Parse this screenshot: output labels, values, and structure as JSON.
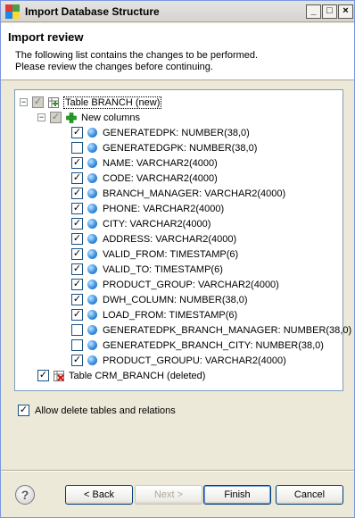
{
  "window": {
    "title": "Import Database Structure",
    "min_glyph": "_",
    "max_glyph": "□",
    "close_glyph": "×"
  },
  "header": {
    "title": "Import review",
    "desc_line1": "The following list contains the changes to be performed.",
    "desc_line2": "Please review the changes before continuing."
  },
  "tree": {
    "branch_table": {
      "label": "Table BRANCH (new)",
      "expanded": true,
      "checked": "gray"
    },
    "new_columns": {
      "label": "New columns",
      "expanded": true,
      "checked": "gray"
    },
    "columns": [
      {
        "label": "GENERATEDPK: NUMBER(38,0)",
        "checked": true
      },
      {
        "label": "GENERATEDGPK: NUMBER(38,0)",
        "checked": false
      },
      {
        "label": "NAME: VARCHAR2(4000)",
        "checked": true
      },
      {
        "label": "CODE: VARCHAR2(4000)",
        "checked": true
      },
      {
        "label": "BRANCH_MANAGER: VARCHAR2(4000)",
        "checked": true
      },
      {
        "label": "PHONE: VARCHAR2(4000)",
        "checked": true
      },
      {
        "label": "CITY: VARCHAR2(4000)",
        "checked": true
      },
      {
        "label": "ADDRESS: VARCHAR2(4000)",
        "checked": true
      },
      {
        "label": "VALID_FROM: TIMESTAMP(6)",
        "checked": true
      },
      {
        "label": "VALID_TO: TIMESTAMP(6)",
        "checked": true
      },
      {
        "label": "PRODUCT_GROUP: VARCHAR2(4000)",
        "checked": true
      },
      {
        "label": "DWH_COLUMN: NUMBER(38,0)",
        "checked": true
      },
      {
        "label": "LOAD_FROM: TIMESTAMP(6)",
        "checked": true
      },
      {
        "label": "GENERATEDPK_BRANCH_MANAGER: NUMBER(38,0)",
        "checked": false
      },
      {
        "label": "GENERATEDPK_BRANCH_CITY: NUMBER(38,0)",
        "checked": false
      },
      {
        "label": "PRODUCT_GROUPU: VARCHAR2(4000)",
        "checked": true
      }
    ],
    "crm_table": {
      "label": "Table CRM_BRANCH (deleted)",
      "checked": true
    }
  },
  "options": {
    "allow_delete_label": "Allow delete tables and relations",
    "allow_delete_checked": true
  },
  "buttons": {
    "help_glyph": "?",
    "back_label": "< Back",
    "next_label": "Next >",
    "finish_label": "Finish",
    "cancel_label": "Cancel"
  },
  "colors": {
    "accent": "#316ac5",
    "add_icon": "#22a022",
    "delete_icon": "#d21010"
  }
}
